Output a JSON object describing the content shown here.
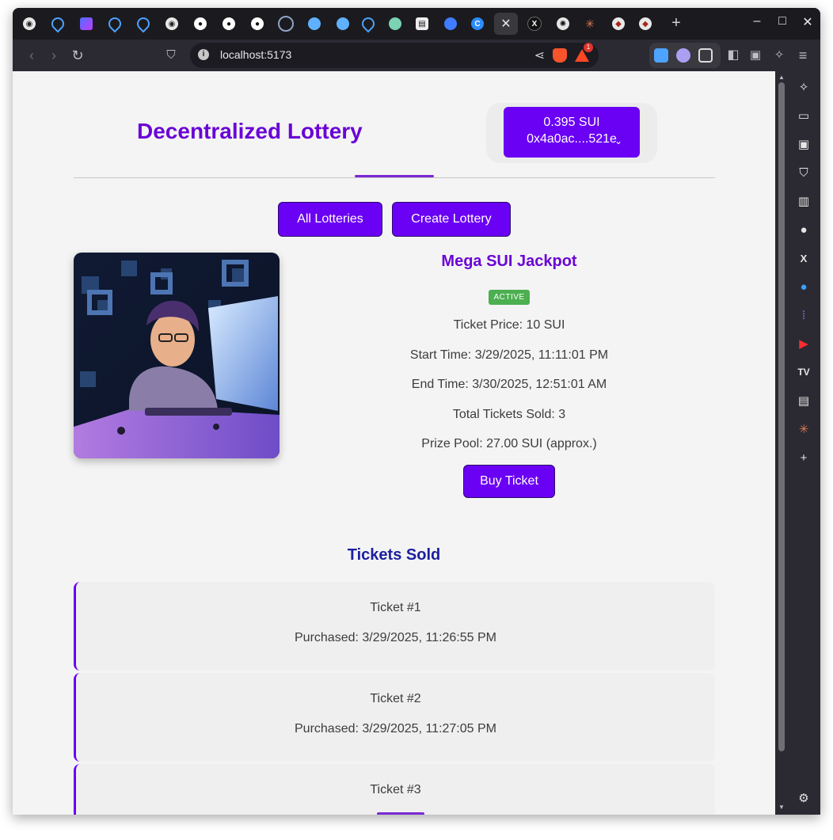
{
  "browser": {
    "url": "localhost:5173",
    "notification_count": "1",
    "new_tab_label": "+",
    "window_controls": [
      "–",
      "□",
      "✕"
    ]
  },
  "header": {
    "title": "Decentralized Lottery",
    "wallet": {
      "balance": "0.395 SUI",
      "address": "0x4a0ac....521e"
    }
  },
  "nav": {
    "all_lotteries": "All Lotteries",
    "create_lottery": "Create Lottery"
  },
  "lottery": {
    "name": "Mega SUI Jackpot",
    "status": "ACTIVE",
    "ticket_price": "Ticket Price: 10 SUI",
    "start_time": "Start Time: 3/29/2025, 11:11:01 PM",
    "end_time": "End Time: 3/30/2025, 12:51:01 AM",
    "total_sold": "Total Tickets Sold: 3",
    "prize_pool": "Prize Pool: 27.00 SUI (approx.)",
    "buy_label": "Buy Ticket"
  },
  "tickets": {
    "title": "Tickets Sold",
    "items": [
      {
        "label": "Ticket #1",
        "purchased": "Purchased: 3/29/2025, 11:26:55 PM"
      },
      {
        "label": "Ticket #2",
        "purchased": "Purchased: 3/29/2025, 11:27:05 PM"
      },
      {
        "label": "Ticket #3",
        "purchased": ""
      }
    ]
  },
  "colors": {
    "accent": "#6a00f4",
    "title": "#6a04d6",
    "active_badge": "#4caf50",
    "section_title": "#1b1fa0"
  }
}
